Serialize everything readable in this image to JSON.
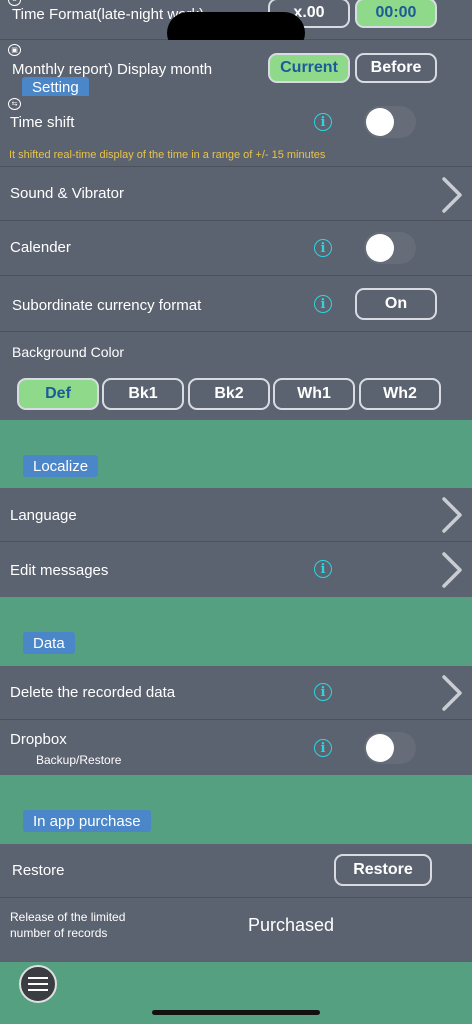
{
  "settings": {
    "time_format": {
      "label": "Time Format(late-night work)",
      "options": [
        "x.00",
        "00:00"
      ],
      "selected": 1
    },
    "monthly_report": {
      "label": "Monthly report) Display month",
      "options": [
        "Current",
        "Before"
      ],
      "selected": 0
    },
    "section_tag": "Setting",
    "time_shift": {
      "label": "Time shift",
      "hint": "It shifted real-time display of the time in a range of +/- 15 minutes",
      "toggle_on": false
    },
    "sound": {
      "label": "Sound & Vibrator"
    },
    "calender": {
      "label": "Calender",
      "toggle_on": false
    },
    "subordinate": {
      "label": "Subordinate currency format",
      "button": "On"
    },
    "background": {
      "label": "Background Color",
      "options": [
        "Def",
        "Bk1",
        "Bk2",
        "Wh1",
        "Wh2"
      ],
      "selected": 0
    }
  },
  "localize": {
    "tag": "Localize",
    "language": "Language",
    "edit_messages": "Edit messages"
  },
  "data_section": {
    "tag": "Data",
    "delete": "Delete the recorded data",
    "dropbox": "Dropbox",
    "dropbox_sub": "Backup/Restore"
  },
  "purchase": {
    "tag": "In app purchase",
    "restore_label": "Restore",
    "restore_button": "Restore",
    "release_line1": "Release of the limited",
    "release_line2": "number of records",
    "release_status": "Purchased"
  },
  "icons": {
    "info": "i"
  },
  "colors": {
    "bg": "#5c6370",
    "section": "#55a080",
    "tag": "#4a86c8",
    "selected": "#8fd98a",
    "info": "#2fd3e0",
    "hint": "#e8c34a"
  }
}
